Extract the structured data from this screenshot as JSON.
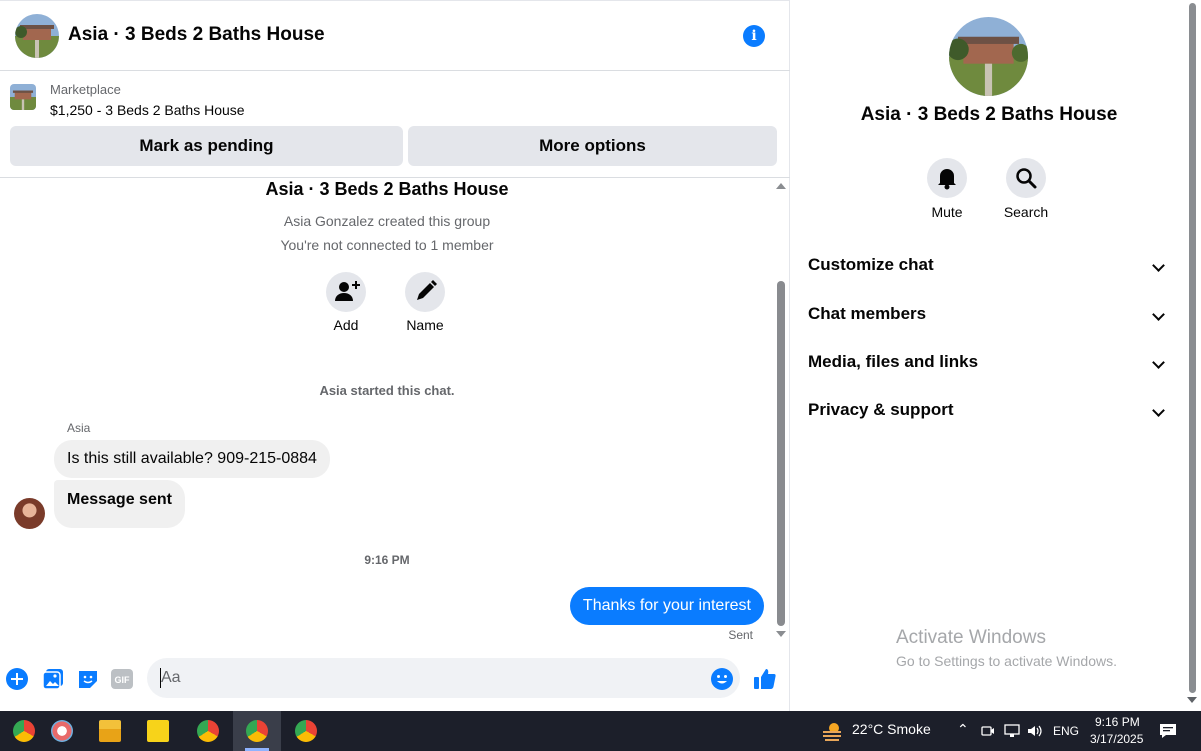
{
  "chat": {
    "title": "Asia · 3 Beds 2 Baths House",
    "listing": {
      "source": "Marketplace",
      "price_title": "$1,250 - 3 Beds 2 Baths House",
      "mark_pending": "Mark as pending",
      "more_options": "More options"
    },
    "thread": {
      "group_title": "Asia · 3 Beds 2 Baths House",
      "created_by": "Asia Gonzalez created this group",
      "connection": "You're not connected to 1 member",
      "add_label": "Add",
      "name_label": "Name",
      "started": "Asia started this chat.",
      "sender": "Asia",
      "incoming": [
        "Is this still available? 909-215-0884",
        "Message sent"
      ],
      "time": "9:16 PM",
      "outgoing": "Thanks for your interest",
      "status": "Sent"
    },
    "composer": {
      "placeholder": "Aa"
    }
  },
  "details": {
    "title": "Asia · 3 Beds 2 Baths House",
    "mute": "Mute",
    "search": "Search",
    "sections": [
      "Customize chat",
      "Chat members",
      "Media, files and links",
      "Privacy & support"
    ],
    "watermark_title": "Activate Windows",
    "watermark_sub": "Go to Settings to activate Windows."
  },
  "taskbar": {
    "weather": "22°C  Smoke",
    "lang": "ENG",
    "time": "9:16 PM",
    "date": "3/17/2025"
  },
  "colors": {
    "accent": "#0a7cff",
    "gray_btn": "#e4e6eb",
    "bubble_in": "#f0f0f0"
  }
}
